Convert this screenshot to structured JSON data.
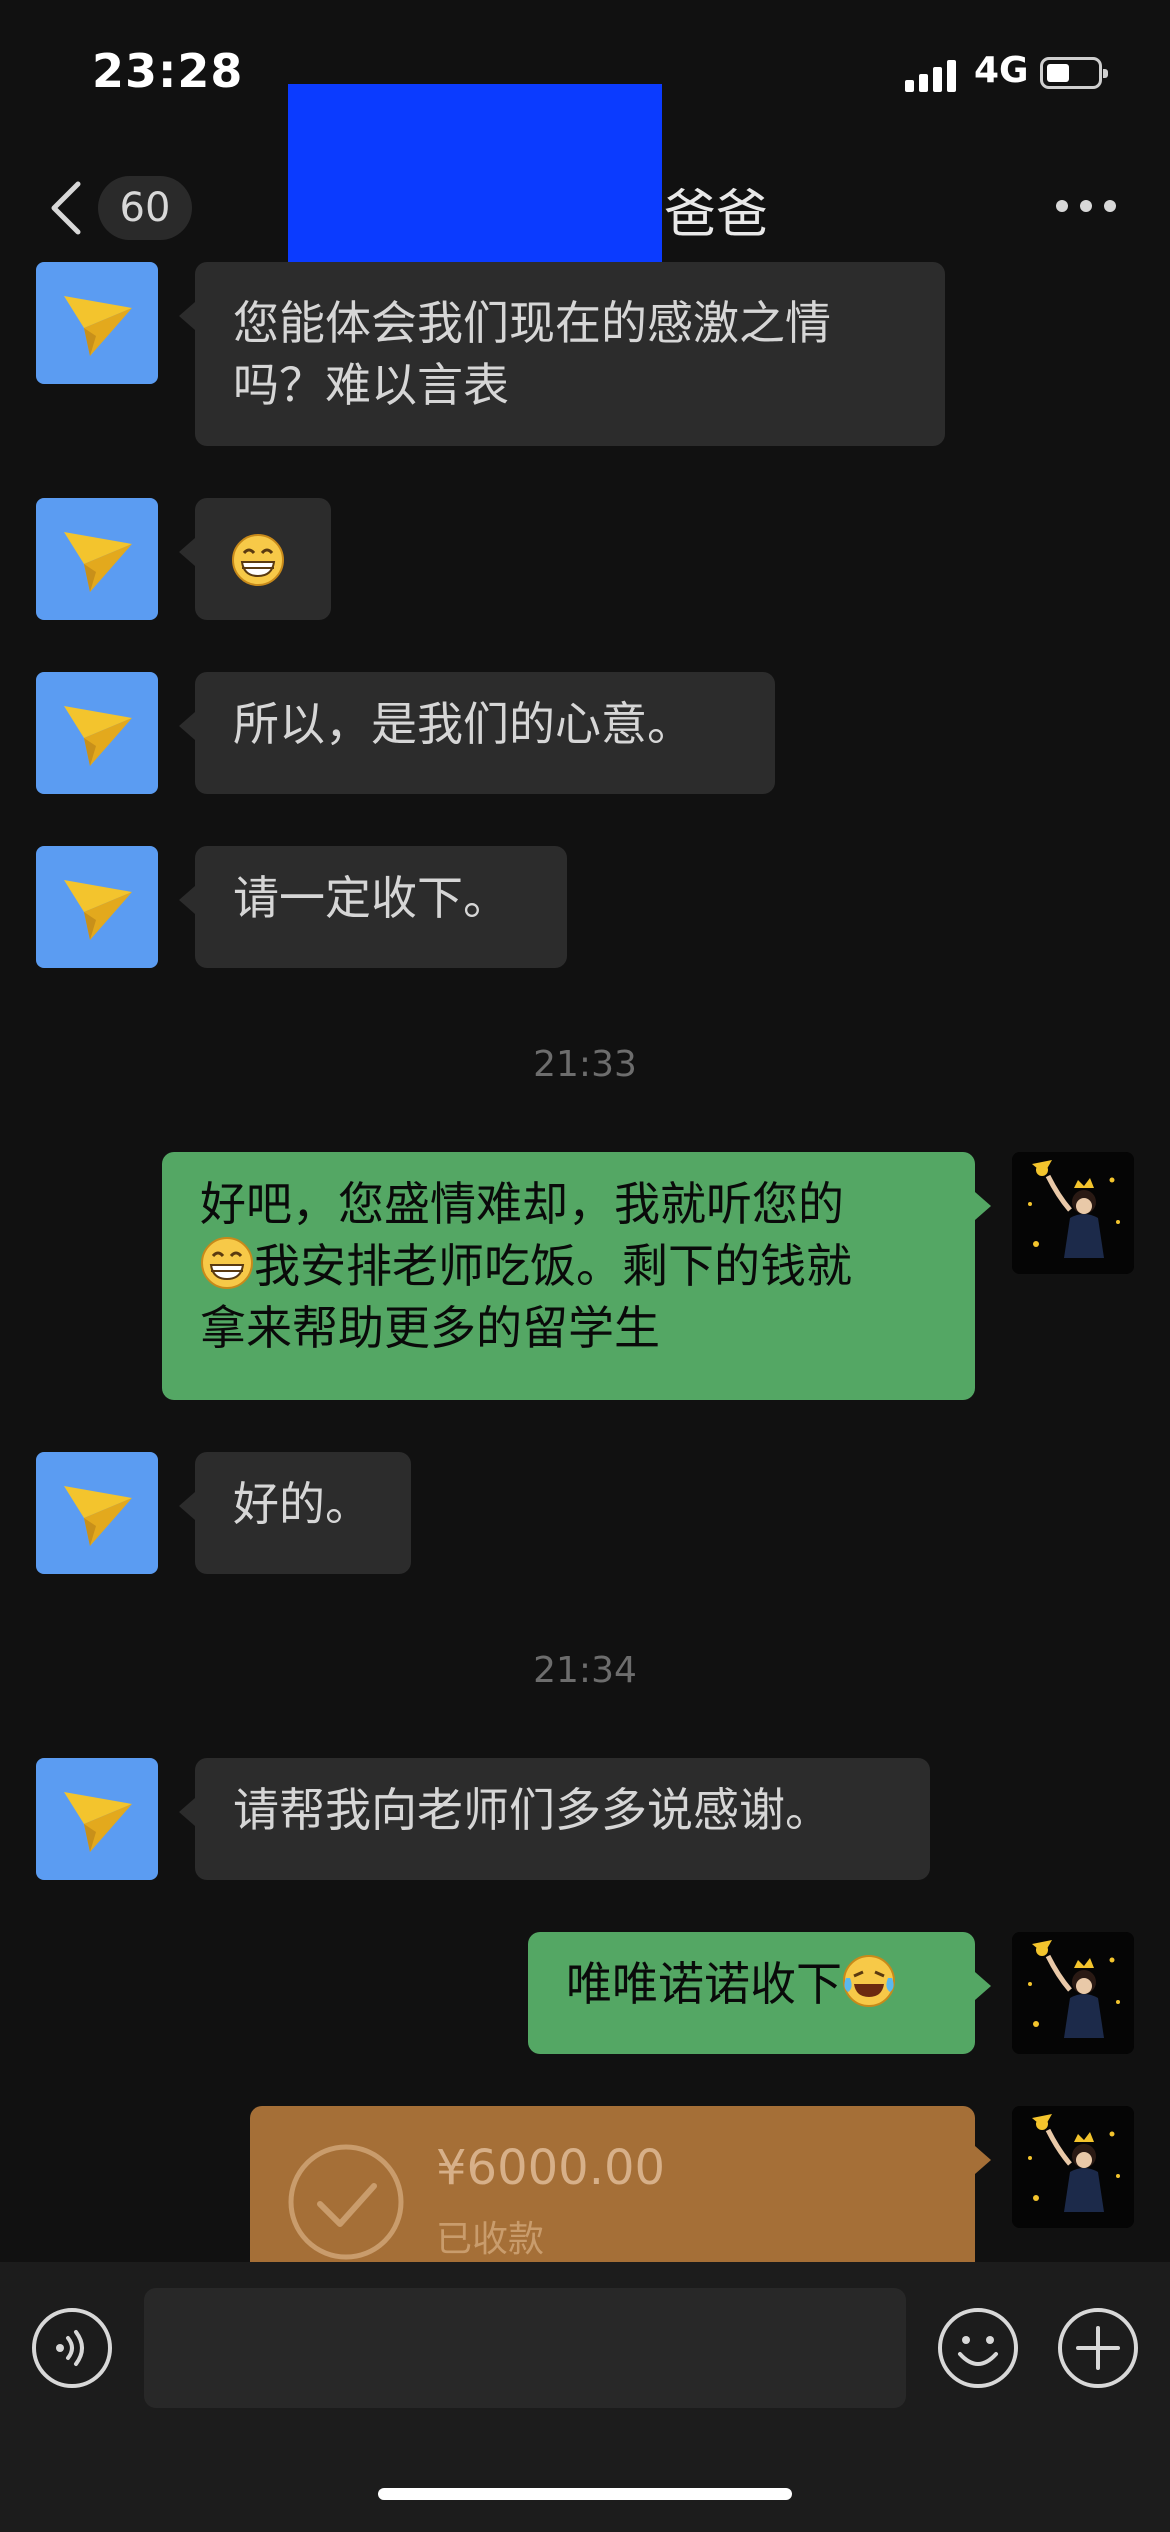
{
  "status_bar": {
    "time": "23:28",
    "network": "4G"
  },
  "header": {
    "unread_count": "60",
    "title": "爸爸"
  },
  "messages": {
    "m1": {
      "line1": "您能体会我们现在的感激之情",
      "line2": "吗？难以言表"
    },
    "m3": "所以，是我们的心意。",
    "m4": "请一定收下。",
    "ts1": "21:33",
    "m5": {
      "line1": "好吧，您盛情难却，我就听您的",
      "line2": "我安排老师吃饭。剩下的钱就",
      "line3": "拿来帮助更多的留学生"
    },
    "m6": "好的。",
    "ts2": "21:34",
    "m7": "请帮我向老师们多多说感谢。",
    "m8": "唯唯诺诺收下"
  },
  "transfer": {
    "amount": "¥6000.00",
    "status": "已收款"
  },
  "icons": {
    "back": "chevron-left-icon",
    "more": "more-dots-icon",
    "avatar_in": "paper-plane-icon",
    "emoji_grin": "grinning-face-icon",
    "emoji_laugh": "laugh-crying-icon",
    "voice": "voice-icon",
    "sticker": "smiley-icon",
    "plus": "plus-icon",
    "check": "checkmark-icon"
  },
  "colors": {
    "background": "#111111",
    "incoming_bubble": "#2c2c2c",
    "outgoing_bubble": "#54a764",
    "transfer_card": "#a56f37",
    "avatar_in": "#5b9cf2",
    "redaction": "#0b3bff"
  }
}
